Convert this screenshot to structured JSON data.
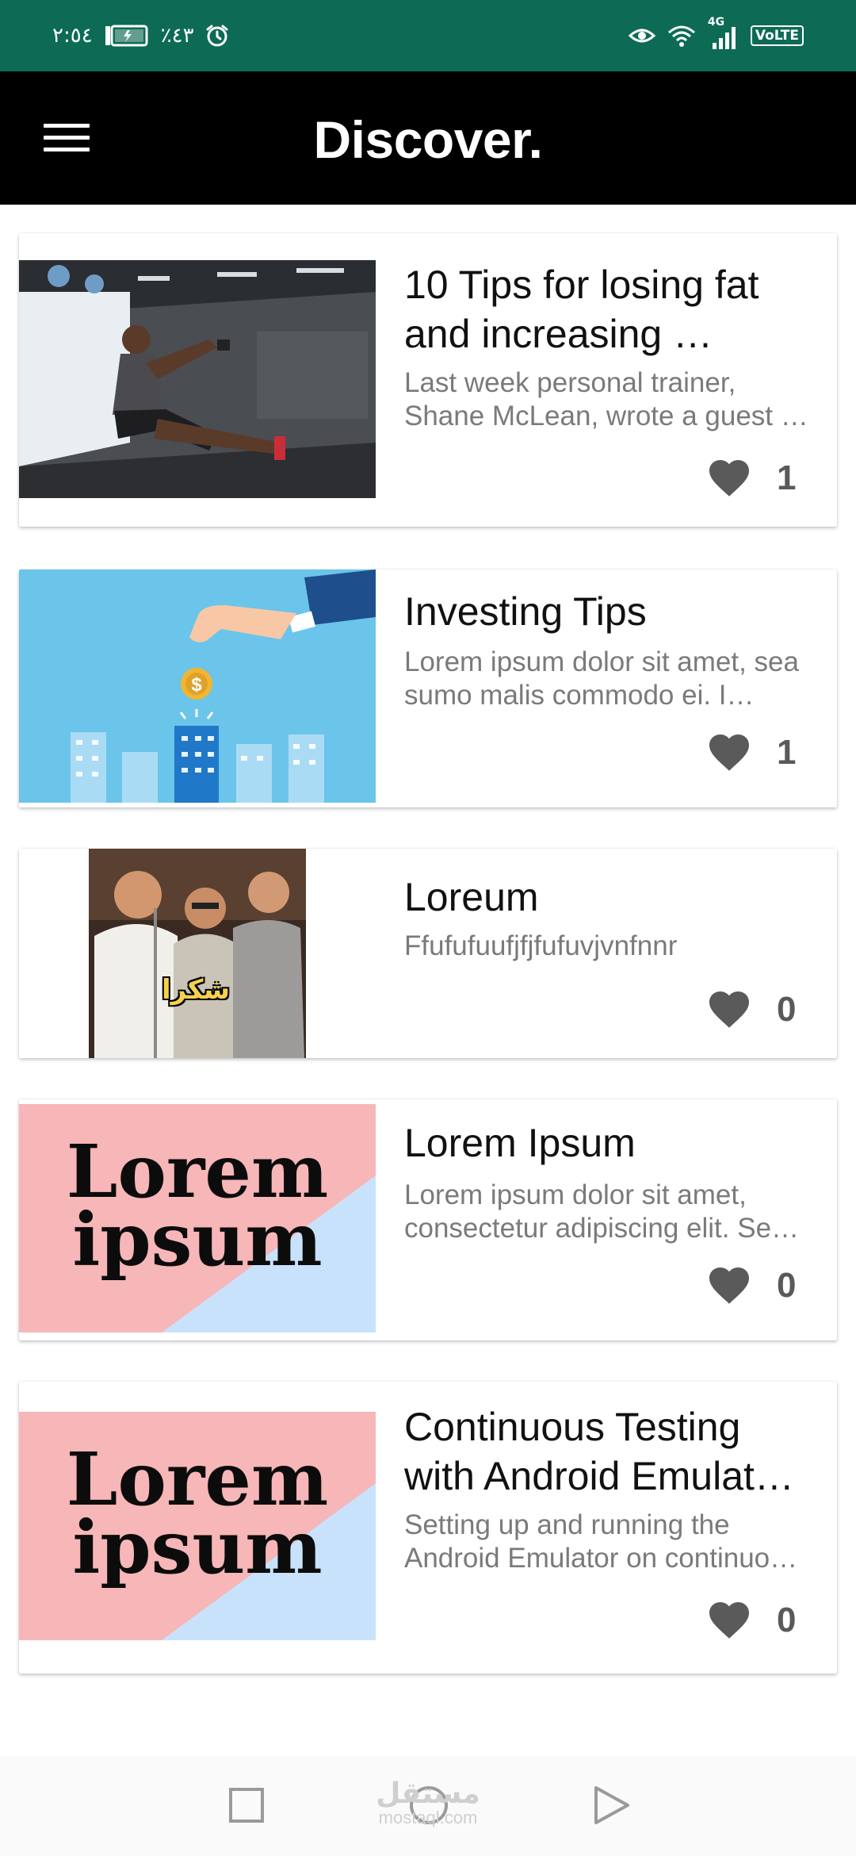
{
  "status_bar": {
    "time": "٢:٥٤",
    "battery": "٪٤٣",
    "network": "4G",
    "volte": "VoLTE"
  },
  "app_bar": {
    "title": "Discover."
  },
  "articles": [
    {
      "title": "10 Tips for losing fat and increasing …",
      "description": "Last week personal trainer, Shane McLean, wrote a guest …",
      "likes": "1"
    },
    {
      "title": "Investing Tips",
      "description": "Lorem ipsum dolor sit amet, sea sumo malis commodo ei. I…",
      "likes": "1"
    },
    {
      "title": "Loreum",
      "description": "Ffufufuufjfjfufuvjvnfnnr",
      "likes": "0",
      "image_caption": "شكرا"
    },
    {
      "title": "Lorem Ipsum",
      "description": "Lorem ipsum dolor sit amet, consectetur adipiscing elit. Se…",
      "likes": "0",
      "image_text": "Lorem ipsum"
    },
    {
      "title": "Continuous Testing with Android Emulat…",
      "description": "Setting up and running the Android Emulator on continuo…",
      "likes": "0",
      "image_text": "Lorem ipsum"
    }
  ],
  "nav_bar": {
    "watermark_ar": "مستقل",
    "watermark_en": "mostaql.com"
  },
  "colors": {
    "status_bar": "#0d6b55",
    "app_bar": "#000000",
    "heart": "#5a5a5a",
    "thumb_pink": "#f7b6b8",
    "thumb_blue": "#c8e2fb",
    "thumb_sky": "#6bc4ea"
  }
}
